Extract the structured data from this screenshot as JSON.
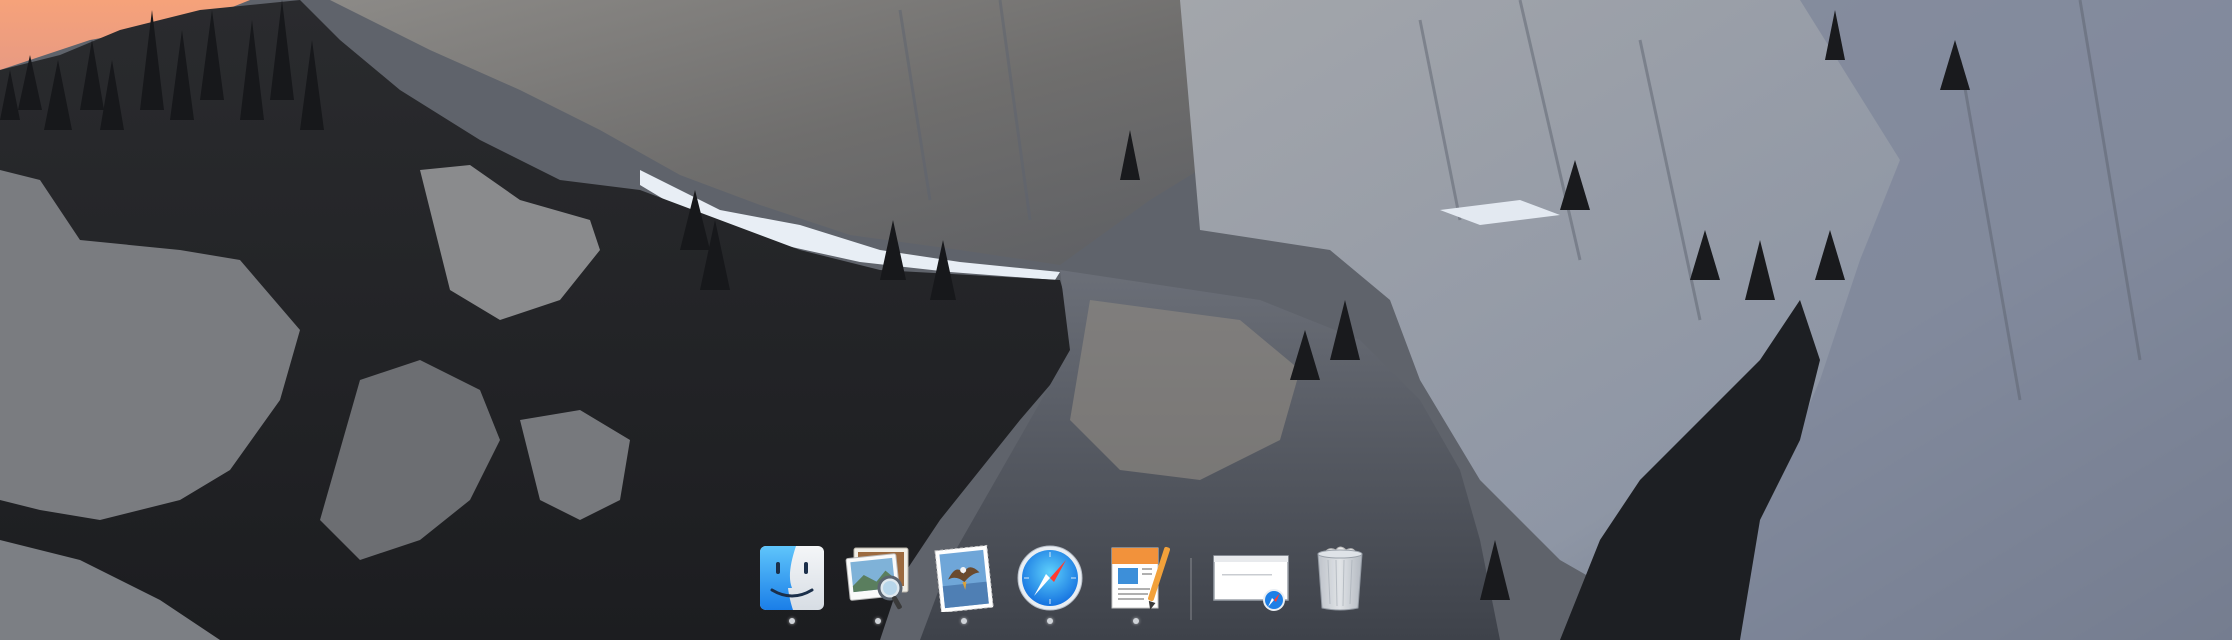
{
  "desktop": {
    "wallpaper": "yosemite-el-capitan-cliff",
    "sky_color": "#f0a07a"
  },
  "dock": {
    "items": [
      {
        "label": "Finder",
        "icon": "finder-icon",
        "running": true
      },
      {
        "label": "Preview",
        "icon": "preview-icon",
        "running": true
      },
      {
        "label": "Mail",
        "icon": "mail-icon",
        "running": true
      },
      {
        "label": "Safari",
        "icon": "safari-icon",
        "running": true
      },
      {
        "label": "Pages",
        "icon": "pages-icon",
        "running": true
      },
      {
        "label": "Safari Window",
        "icon": "minimized-safari-window-icon",
        "running": false
      },
      {
        "label": "Trash",
        "icon": "trash-icon",
        "running": false
      }
    ]
  }
}
